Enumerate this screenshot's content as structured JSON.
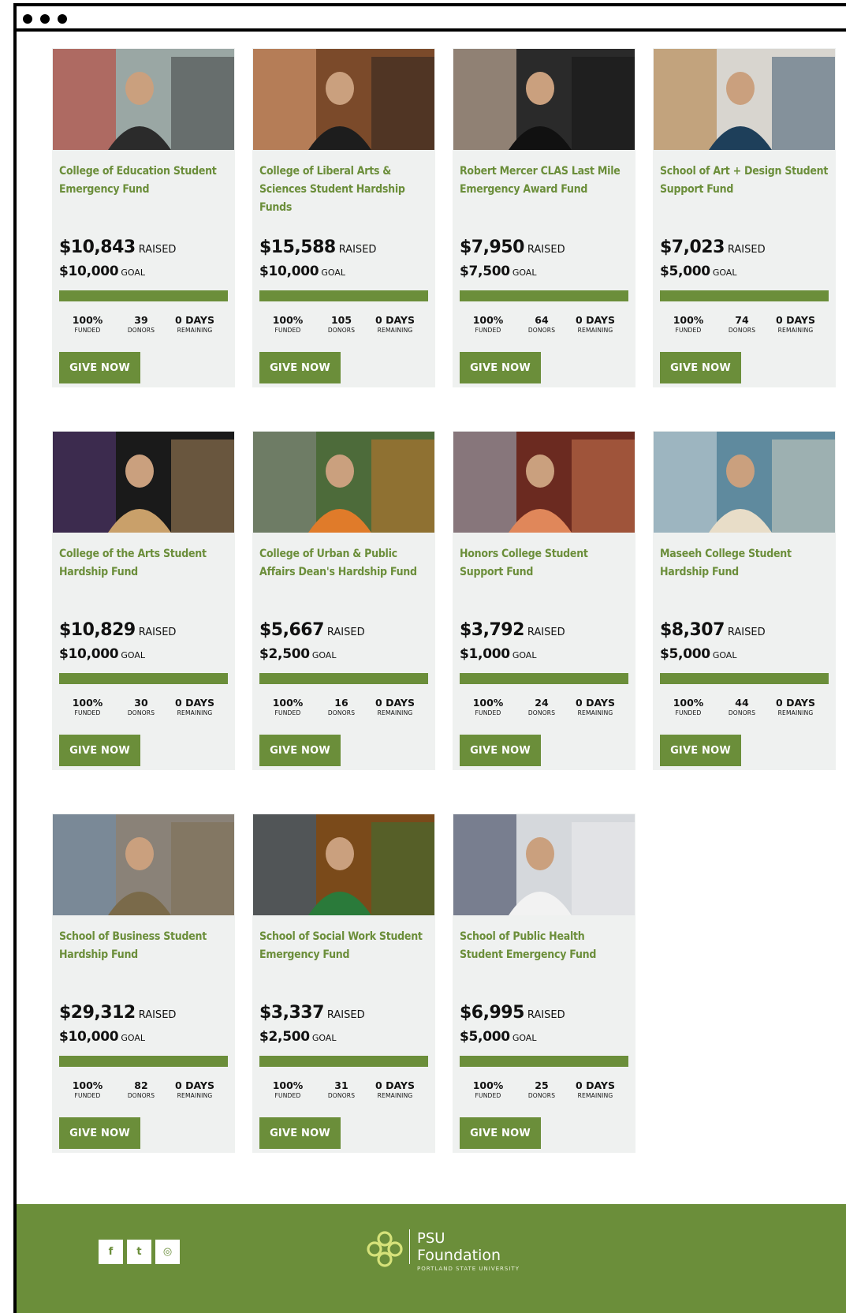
{
  "window": {
    "controls": [
      "close-dot",
      "minimize-dot",
      "maximize-dot"
    ]
  },
  "labels": {
    "raised": "RAISED",
    "goal": "GOAL",
    "funded": "FUNDED",
    "donors": "DONORS",
    "remaining": "REMAINING",
    "give_now": "GIVE NOW"
  },
  "cards": [
    {
      "title": "College of Education Student Emergency Fund",
      "raised": "$10,843",
      "goal": "$10,000",
      "funded_pct": "100%",
      "progress": 1.0,
      "donors": "39",
      "days": "0 DAYS",
      "photo_colors": [
        "#9aa7a4",
        "#c0392b",
        "#2b2b2b"
      ]
    },
    {
      "title": "College of Liberal Arts & Sciences Student Hardship Funds",
      "raised": "$15,588",
      "goal": "$10,000",
      "funded_pct": "100%",
      "progress": 1.0,
      "donors": "105",
      "days": "0 DAYS",
      "photo_colors": [
        "#7b4a2a",
        "#e6a77c",
        "#1d1d1d"
      ]
    },
    {
      "title": "Robert Mercer CLAS Last Mile Emergency Award Fund",
      "raised": "$7,950",
      "goal": "$7,500",
      "funded_pct": "100%",
      "progress": 1.0,
      "donors": "64",
      "days": "0 DAYS",
      "photo_colors": [
        "#2a2a2a",
        "#e3c9b0",
        "#111111"
      ]
    },
    {
      "title": "School of Art + Design Student Support Fund",
      "raised": "$7,023",
      "goal": "$5,000",
      "funded_pct": "100%",
      "progress": 1.0,
      "donors": "74",
      "days": "0 DAYS",
      "photo_colors": [
        "#d8d5cf",
        "#b07a3a",
        "#1e3f5a"
      ]
    },
    {
      "title": "College of the Arts Student Hardship Fund",
      "raised": "$10,829",
      "goal": "$10,000",
      "funded_pct": "100%",
      "progress": 1.0,
      "donors": "30",
      "days": "0 DAYS",
      "photo_colors": [
        "#1a1a1a",
        "#5a3a7a",
        "#c9a06a"
      ]
    },
    {
      "title": "College of Urban & Public Affairs Dean's Hardship Fund",
      "raised": "$5,667",
      "goal": "$2,500",
      "funded_pct": "100%",
      "progress": 1.0,
      "donors": "16",
      "days": "0 DAYS",
      "photo_colors": [
        "#4d6b3a",
        "#8a8a88",
        "#e07b2a"
      ]
    },
    {
      "title": "Honors College Student Support Fund",
      "raised": "$3,792",
      "goal": "$1,000",
      "funded_pct": "100%",
      "progress": 1.0,
      "donors": "24",
      "days": "0 DAYS",
      "photo_colors": [
        "#6b2a20",
        "#9fb4c7",
        "#e0875a"
      ]
    },
    {
      "title": "Maseeh College Student Hardship Fund",
      "raised": "$8,307",
      "goal": "$5,000",
      "funded_pct": "100%",
      "progress": 1.0,
      "donors": "44",
      "days": "0 DAYS",
      "photo_colors": [
        "#5f8a9e",
        "#cfd8dc",
        "#e8ddc8"
      ]
    },
    {
      "title": "School of Business Student Hardship Fund",
      "raised": "$29,312",
      "goal": "$10,000",
      "funded_pct": "100%",
      "progress": 1.0,
      "donors": "82",
      "days": "0 DAYS",
      "photo_colors": [
        "#8a8278",
        "#6e8fb0",
        "#7a6a4a"
      ]
    },
    {
      "title": "School of Social Work Student Emergency Fund",
      "raised": "$3,337",
      "goal": "$2,500",
      "funded_pct": "100%",
      "progress": 1.0,
      "donors": "31",
      "days": "0 DAYS",
      "photo_colors": [
        "#7a4a1a",
        "#2f5f8a",
        "#2a7a3a"
      ]
    },
    {
      "title": "School of Public Health Student Emergency Fund",
      "raised": "$6,995",
      "goal": "$5,000",
      "funded_pct": "100%",
      "progress": 1.0,
      "donors": "25",
      "days": "0 DAYS",
      "photo_colors": [
        "#d5d8dc",
        "#2b3550",
        "#f2f2f2"
      ]
    }
  ],
  "footer": {
    "background": "#6b8e3a",
    "social": [
      {
        "icon": "facebook-icon",
        "glyph": "f"
      },
      {
        "icon": "twitter-icon",
        "glyph": "t"
      },
      {
        "icon": "instagram-icon",
        "glyph": "◎"
      }
    ],
    "logo_line1": "PSU",
    "logo_line2": "Foundation",
    "logo_line3": "PORTLAND STATE UNIVERSITY"
  },
  "colors": {
    "accent": "#6b8e3a",
    "card_bg": "#eff1f0",
    "text": "#111111"
  }
}
